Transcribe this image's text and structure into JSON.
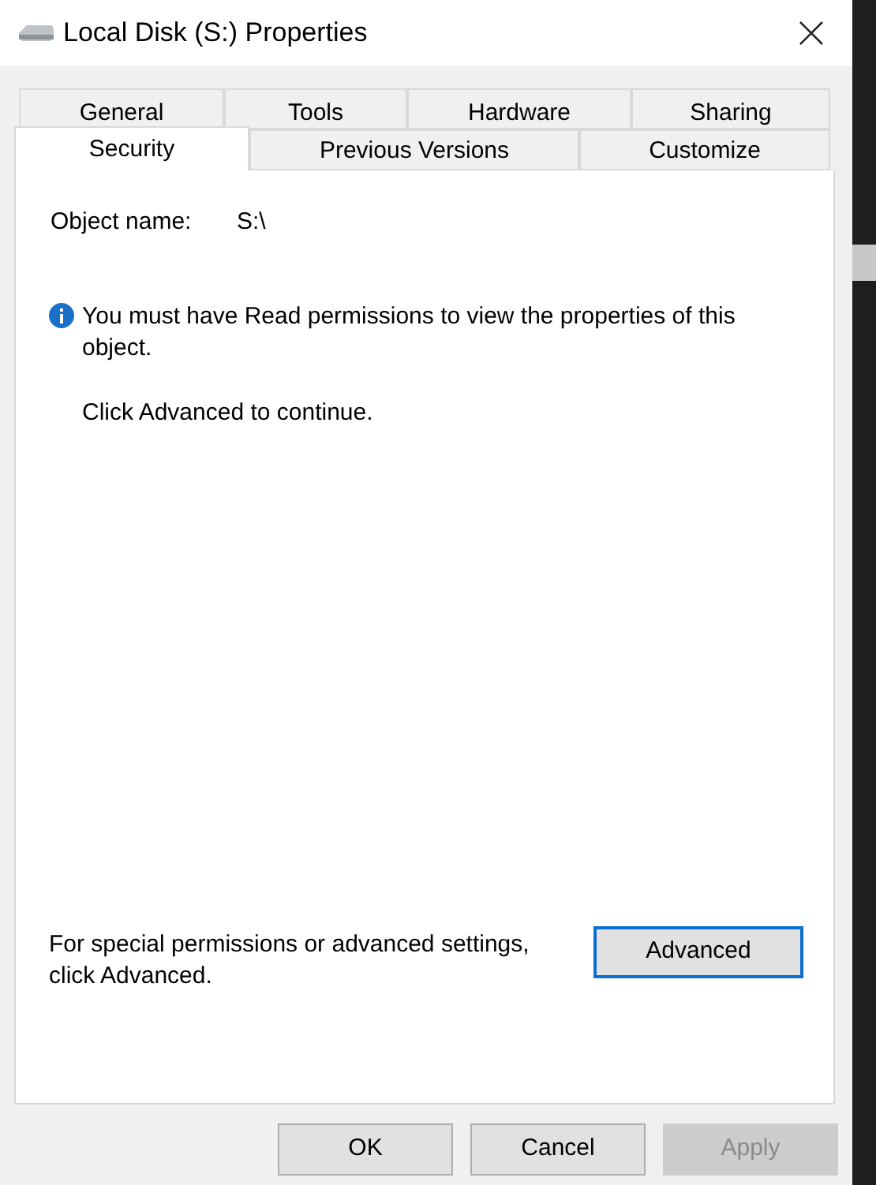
{
  "window": {
    "title": "Local Disk (S:) Properties"
  },
  "tab_rows": [
    [
      {
        "label": "General",
        "selected": false
      },
      {
        "label": "Tools",
        "selected": false
      },
      {
        "label": "Hardware",
        "selected": false
      },
      {
        "label": "Sharing",
        "selected": false
      }
    ],
    [
      {
        "label": "Security",
        "selected": true
      },
      {
        "label": "Previous Versions",
        "selected": false
      },
      {
        "label": "Customize",
        "selected": false
      }
    ]
  ],
  "object_name": {
    "label": "Object name:",
    "value": "S:\\"
  },
  "info_message": "You must have Read permissions to view the properties of this object.",
  "continue_hint": "Click Advanced to continue.",
  "advanced_hint": "For special permissions or advanced settings, click Advanced.",
  "advanced_button": {
    "label": "Advanced",
    "focused": true
  },
  "buttons": [
    {
      "label": "OK",
      "disabled": false
    },
    {
      "label": "Cancel",
      "disabled": false
    },
    {
      "label": "Apply",
      "disabled": true
    }
  ]
}
